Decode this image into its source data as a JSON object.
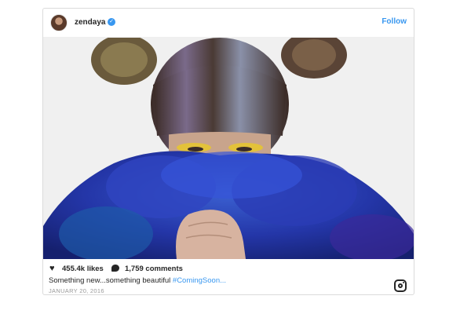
{
  "post": {
    "username": "zendaya",
    "verified_icon": "verified-check-icon",
    "follow_label": "Follow",
    "likes": "455.4k likes",
    "comments": "1,759 comments",
    "caption_text": "Something new...something beautiful ",
    "caption_hashtag": "#ComingSoon...",
    "date": "JANUARY 20, 2016"
  },
  "icons": {
    "like": "heart-icon",
    "comment": "comment-icon",
    "brand": "instagram-icon"
  },
  "colors": {
    "accent": "#3897f0",
    "text": "#262626",
    "muted": "#999999"
  }
}
